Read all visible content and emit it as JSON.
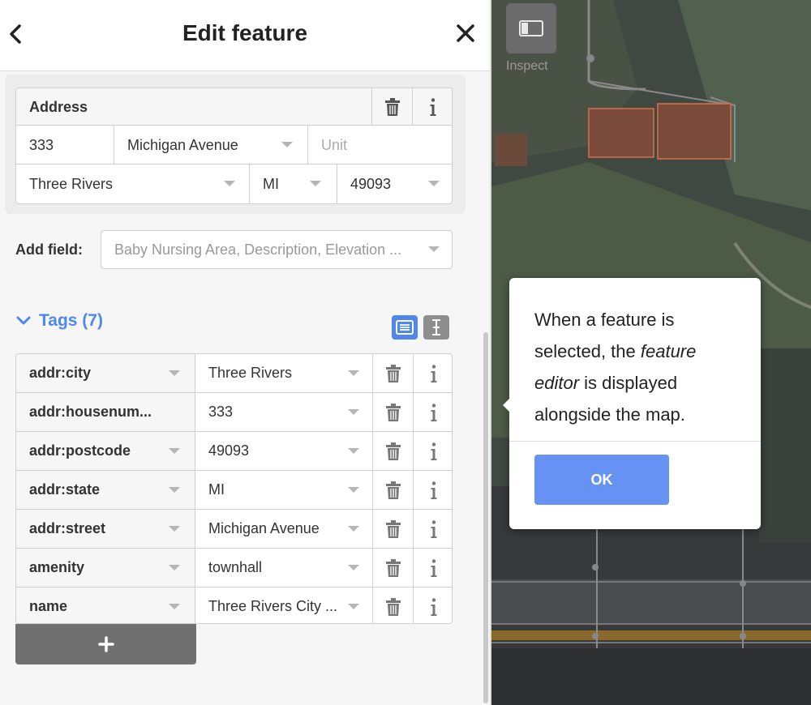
{
  "header": {
    "title": "Edit feature",
    "back_icon": "chevron-left-icon",
    "close_icon": "close-icon"
  },
  "address": {
    "label": "Address",
    "housenumber": "333",
    "street": "Michigan Avenue",
    "unit_placeholder": "Unit",
    "city": "Three Rivers",
    "state": "MI",
    "postcode": "49093"
  },
  "add_field": {
    "label": "Add field:",
    "placeholder": "Baby Nursing Area, Description, Elevation ..."
  },
  "tags": {
    "toggle_label": "Tags (7)",
    "rows": [
      {
        "key": "addr:city",
        "value": "Three Rivers"
      },
      {
        "key": "addr:housenum...",
        "value": "333"
      },
      {
        "key": "addr:postcode",
        "value": "49093"
      },
      {
        "key": "addr:state",
        "value": "MI"
      },
      {
        "key": "addr:street",
        "value": "Michigan Avenue"
      },
      {
        "key": "amenity",
        "value": "townhall"
      },
      {
        "key": "name",
        "value": "Three Rivers City ..."
      }
    ],
    "add_label": "+"
  },
  "map": {
    "inspect_label": "Inspect"
  },
  "popup": {
    "text_1": "When a feature is selected, the ",
    "text_em": "feature editor",
    "text_2": " is displayed alongside the map.",
    "ok_label": "OK"
  },
  "colors": {
    "accent": "#4f86f0",
    "ok_button": "#6592f3",
    "building_outline": "#d8704a"
  }
}
